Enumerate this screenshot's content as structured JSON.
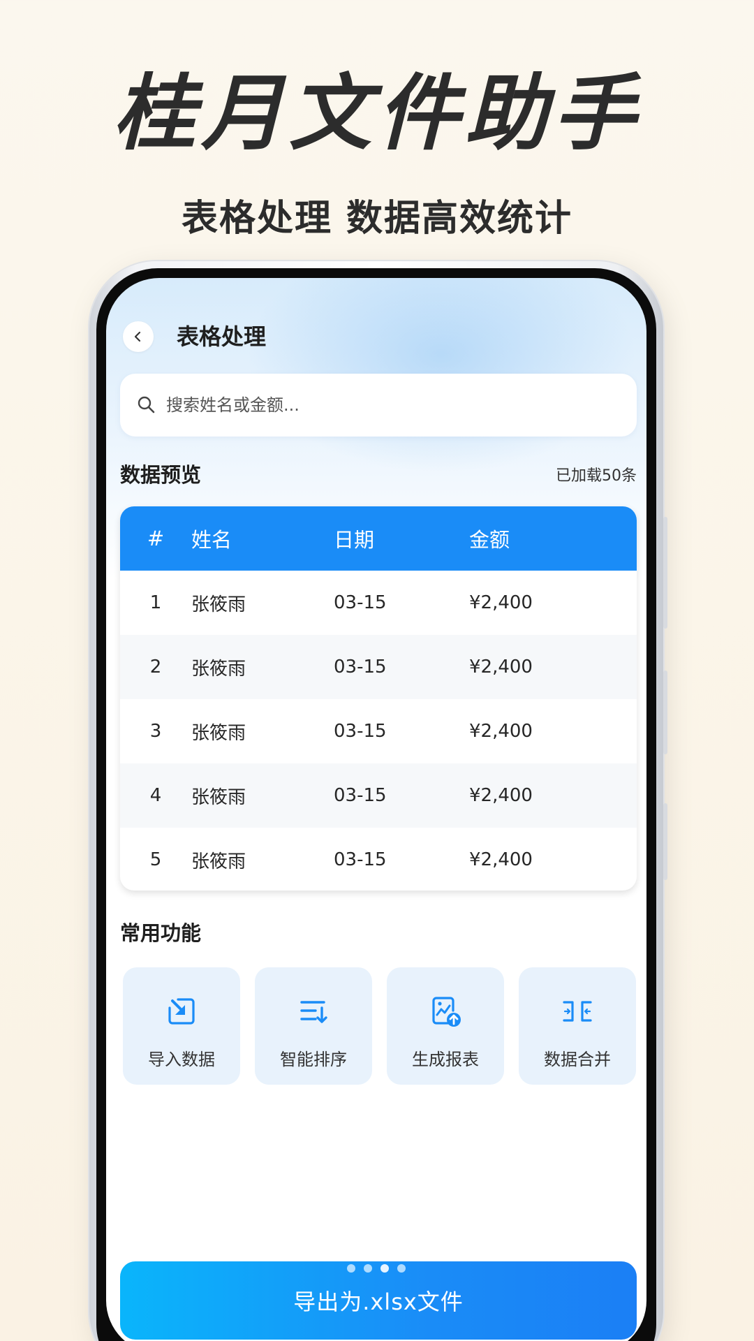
{
  "hero": {
    "title": "桂月文件助手",
    "subtitle": "表格处理 数据高效统计"
  },
  "nav": {
    "back_icon": "chevron-left-icon",
    "title": "表格处理"
  },
  "search": {
    "icon": "search-icon",
    "placeholder": "搜索姓名或金额..."
  },
  "preview": {
    "title": "数据预览",
    "loaded": "已加载50条"
  },
  "table": {
    "header_color": "#1a8cf7",
    "columns": [
      "#",
      "姓名",
      "日期",
      "金额"
    ],
    "rows": [
      {
        "idx": "1",
        "name": "张筱雨",
        "date": "03-15",
        "amount": "¥2,400"
      },
      {
        "idx": "2",
        "name": "张筱雨",
        "date": "03-15",
        "amount": "¥2,400"
      },
      {
        "idx": "3",
        "name": "张筱雨",
        "date": "03-15",
        "amount": "¥2,400"
      },
      {
        "idx": "4",
        "name": "张筱雨",
        "date": "03-15",
        "amount": "¥2,400"
      },
      {
        "idx": "5",
        "name": "张筱雨",
        "date": "03-15",
        "amount": "¥2,400"
      }
    ]
  },
  "features": {
    "title": "常用功能",
    "items": [
      {
        "label": "导入数据",
        "icon": "import-icon"
      },
      {
        "label": "智能排序",
        "icon": "sort-icon"
      },
      {
        "label": "生成报表",
        "icon": "report-upload-icon"
      },
      {
        "label": "数据合并",
        "icon": "merge-icon"
      }
    ]
  },
  "pager": {
    "count": 4,
    "active_index": 2
  },
  "export": {
    "label": "导出为.xlsx文件"
  }
}
